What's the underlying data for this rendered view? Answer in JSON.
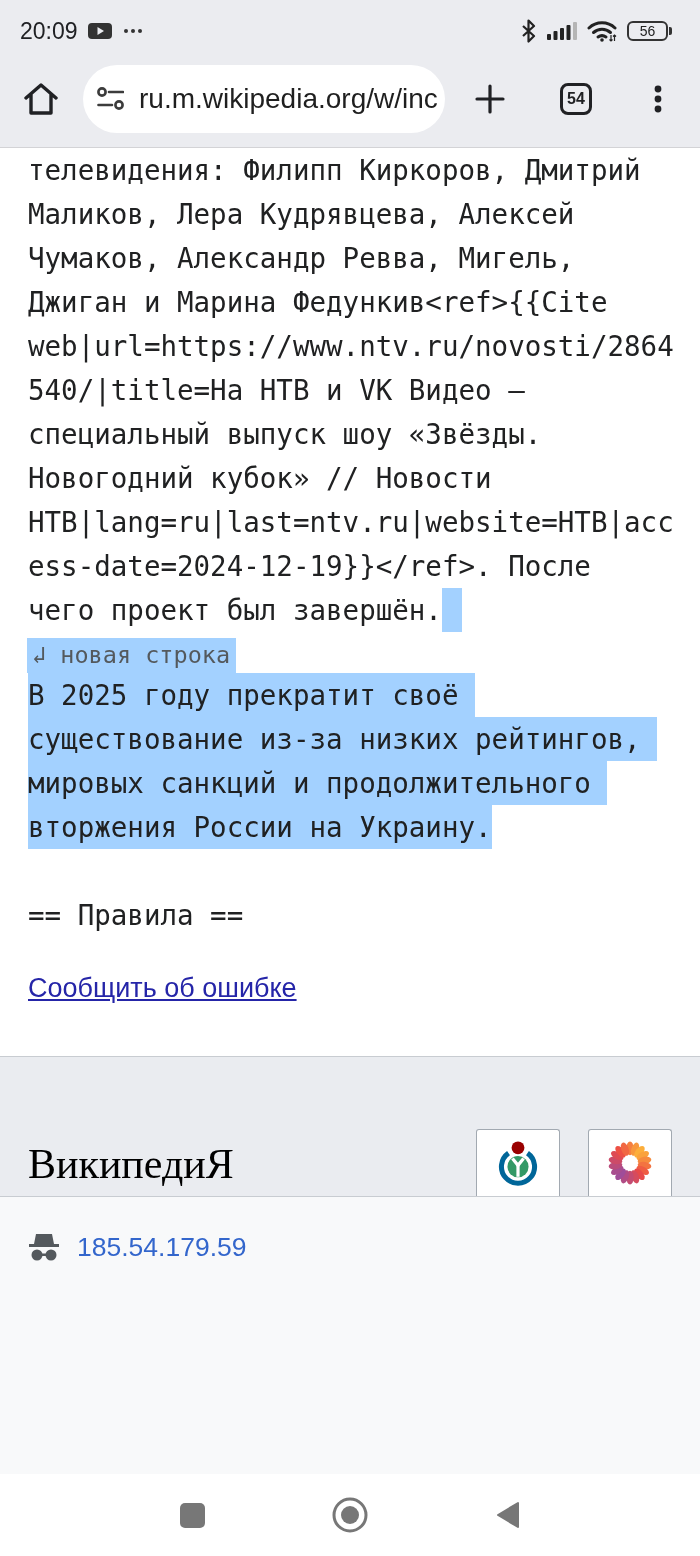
{
  "status_bar": {
    "time": "20:09",
    "battery": "56"
  },
  "browser_toolbar": {
    "url": "ru.m.wikipedia.org/w/inc",
    "tab_count": "54"
  },
  "editor": {
    "blocks": [
      {
        "kind": "text",
        "added": false,
        "trailing_added": true,
        "lines": [
          "телевидения: Филипп Киркоров, Дмитрий",
          "Маликов, Лера Кудрявцева, Алексей",
          "Чумаков, Александр Ревва, Мигель,",
          "Джиган и Марина Федункив<ref>{{Cite",
          "web|url=https://www.ntv.ru/novosti/2864",
          "540/|title=На НТВ и VK Видео —",
          "специальный выпуск шоу «Звёзды.",
          "Новогодний кубок» // Новости",
          "НТВ|lang=ru|last=ntv.ru|website=НТВ|acc",
          "ess-date=2024-12-19}}</ref>. После",
          "чего проект был завершён."
        ]
      },
      {
        "kind": "marker",
        "added": true,
        "text": "↲ новая строка"
      },
      {
        "kind": "text",
        "added": true,
        "trailing_added": false,
        "lines": [
          "В 2025 году прекратит своё",
          "существование из-за низких рейтингов,",
          "мировых санкций и продолжительного",
          "вторжения России на Украину."
        ]
      },
      {
        "kind": "heading",
        "added": false,
        "trailing_added": false,
        "lines": [
          "== Правила =="
        ]
      }
    ]
  },
  "report_link": "Сообщить об ошибке",
  "footer": {
    "wordmark": "ВикипедиЯ",
    "logo_buttons": [
      {
        "kind": "ring"
      },
      {
        "kind": "flower"
      }
    ]
  },
  "account": {
    "ip_address": "185.54.179.59"
  }
}
